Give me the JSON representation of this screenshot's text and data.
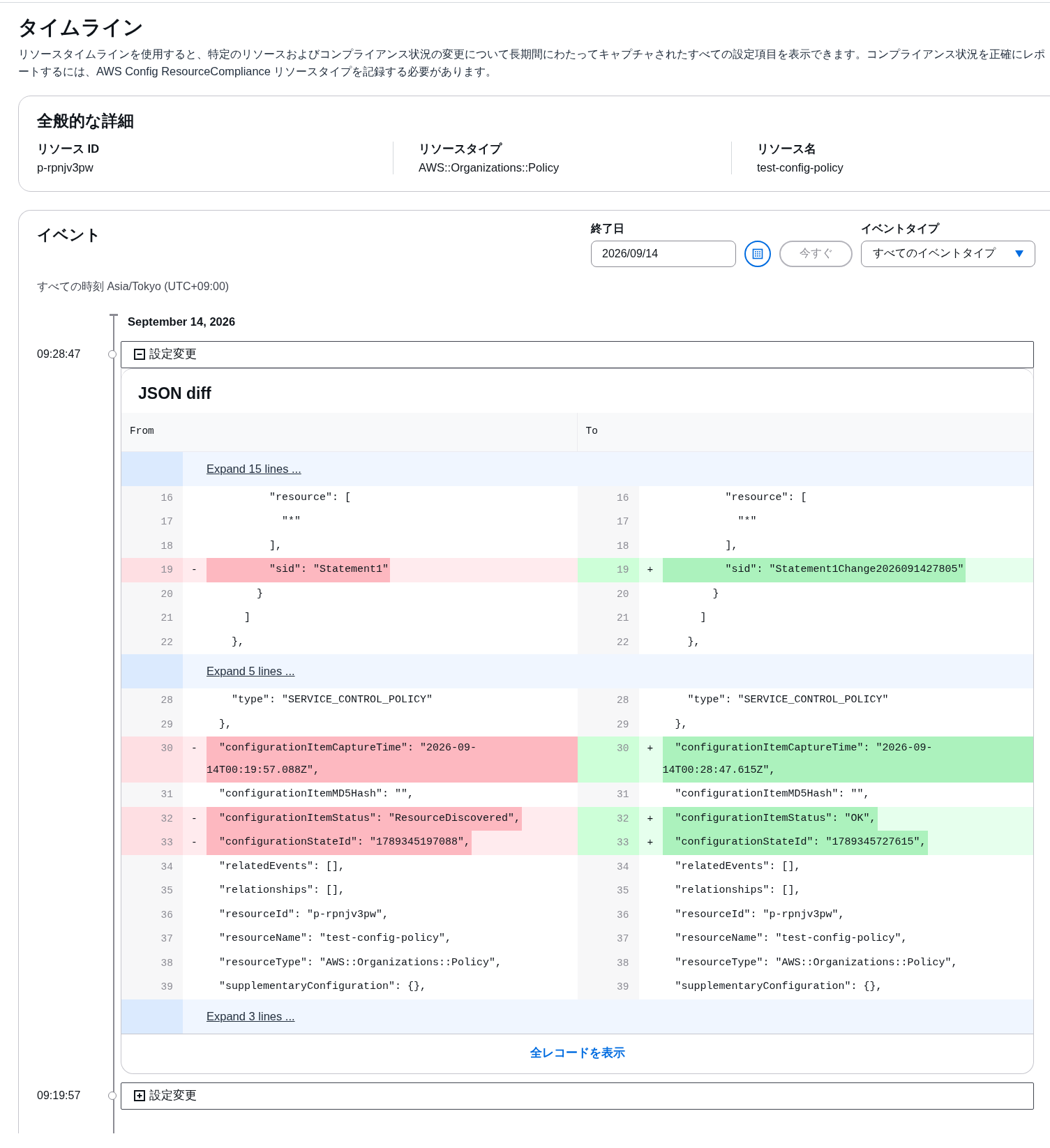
{
  "page": {
    "title": "タイムライン",
    "description": "リソースタイムラインを使用すると、特定のリソースおよびコンプライアンス状況の変更について長期間にわたってキャプチャされたすべての設定項目を表示できます。コンプライアンス状況を正確にレポートするには、AWS Config ResourceCompliance リソースタイプを記録する必要があります。"
  },
  "general": {
    "title": "全般的な詳細",
    "fields": [
      {
        "label": "リソース ID",
        "value": "p-rpnjv3pw"
      },
      {
        "label": "リソースタイプ",
        "value": "AWS::Organizations::Policy"
      },
      {
        "label": "リソース名",
        "value": "test-config-policy"
      }
    ]
  },
  "events_panel": {
    "title": "イベント",
    "timezone": "すべての時刻 Asia/Tokyo (UTC+09:00)",
    "end_date": {
      "label": "終了日",
      "value": "2026/09/14"
    },
    "now_button": {
      "label": "今すぐ",
      "disabled": true
    },
    "event_type": {
      "label": "イベントタイプ",
      "value": "すべてのイベントタイプ"
    },
    "date_heading": "September 14, 2026",
    "events": [
      {
        "time": "09:28:47",
        "label": "設定変更",
        "expanded": true,
        "diff": {
          "title": "JSON diff",
          "from_label": "From",
          "to_label": "To",
          "footer_link": "全レコードを表示",
          "rows": [
            {
              "kind": "expand",
              "label": "Expand 15 lines ..."
            },
            {
              "kind": "line",
              "from": {
                "num": "16",
                "text": "          \"resource\": [",
                "kind": "context"
              },
              "to": {
                "num": "16",
                "text": "          \"resource\": [",
                "kind": "context"
              }
            },
            {
              "kind": "line",
              "from": {
                "num": "17",
                "text": "            \"*\"",
                "kind": "context"
              },
              "to": {
                "num": "17",
                "text": "            \"*\"",
                "kind": "context"
              }
            },
            {
              "kind": "line",
              "from": {
                "num": "18",
                "text": "          ],",
                "kind": "context"
              },
              "to": {
                "num": "18",
                "text": "          ],",
                "kind": "context"
              }
            },
            {
              "kind": "line",
              "from": {
                "num": "19",
                "marker": "-",
                "text": "          \"sid\": \"Statement1\"",
                "kind": "removed"
              },
              "to": {
                "num": "19",
                "marker": "+",
                "text": "          \"sid\": \"Statement1Change2026091427805\"",
                "kind": "added"
              }
            },
            {
              "kind": "line",
              "from": {
                "num": "20",
                "text": "        }",
                "kind": "context"
              },
              "to": {
                "num": "20",
                "text": "        }",
                "kind": "context"
              }
            },
            {
              "kind": "line",
              "from": {
                "num": "21",
                "text": "      ]",
                "kind": "context"
              },
              "to": {
                "num": "21",
                "text": "      ]",
                "kind": "context"
              }
            },
            {
              "kind": "line",
              "from": {
                "num": "22",
                "text": "    },",
                "kind": "context"
              },
              "to": {
                "num": "22",
                "text": "    },",
                "kind": "context"
              }
            },
            {
              "kind": "expand",
              "label": "Expand 5 lines ..."
            },
            {
              "kind": "line",
              "from": {
                "num": "28",
                "text": "    \"type\": \"SERVICE_CONTROL_POLICY\"",
                "kind": "context"
              },
              "to": {
                "num": "28",
                "text": "    \"type\": \"SERVICE_CONTROL_POLICY\"",
                "kind": "context"
              }
            },
            {
              "kind": "line",
              "from": {
                "num": "29",
                "text": "  },",
                "kind": "context"
              },
              "to": {
                "num": "29",
                "text": "  },",
                "kind": "context"
              }
            },
            {
              "kind": "line",
              "from": {
                "num": "30",
                "marker": "-",
                "text": "  \"configurationItemCaptureTime\": \"2026-09-14T00:19:57.088Z\",",
                "kind": "removed"
              },
              "to": {
                "num": "30",
                "marker": "+",
                "text": "  \"configurationItemCaptureTime\": \"2026-09-14T00:28:47.615Z\",",
                "kind": "added"
              }
            },
            {
              "kind": "line",
              "from": {
                "num": "31",
                "text": "  \"configurationItemMD5Hash\": \"\",",
                "kind": "context"
              },
              "to": {
                "num": "31",
                "text": "  \"configurationItemMD5Hash\": \"\",",
                "kind": "context"
              }
            },
            {
              "kind": "line",
              "from": {
                "num": "32",
                "marker": "-",
                "text": "  \"configurationItemStatus\": \"ResourceDiscovered\",",
                "kind": "removed"
              },
              "to": {
                "num": "32",
                "marker": "+",
                "text": "  \"configurationItemStatus\": \"OK\",",
                "kind": "added"
              }
            },
            {
              "kind": "line",
              "from": {
                "num": "33",
                "marker": "-",
                "text": "  \"configurationStateId\": \"1789345197088\",",
                "kind": "removed"
              },
              "to": {
                "num": "33",
                "marker": "+",
                "text": "  \"configurationStateId\": \"1789345727615\",",
                "kind": "added"
              }
            },
            {
              "kind": "line",
              "from": {
                "num": "34",
                "text": "  \"relatedEvents\": [],",
                "kind": "context"
              },
              "to": {
                "num": "34",
                "text": "  \"relatedEvents\": [],",
                "kind": "context"
              }
            },
            {
              "kind": "line",
              "from": {
                "num": "35",
                "text": "  \"relationships\": [],",
                "kind": "context"
              },
              "to": {
                "num": "35",
                "text": "  \"relationships\": [],",
                "kind": "context"
              }
            },
            {
              "kind": "line",
              "from": {
                "num": "36",
                "text": "  \"resourceId\": \"p-rpnjv3pw\",",
                "kind": "context"
              },
              "to": {
                "num": "36",
                "text": "  \"resourceId\": \"p-rpnjv3pw\",",
                "kind": "context"
              }
            },
            {
              "kind": "line",
              "from": {
                "num": "37",
                "text": "  \"resourceName\": \"test-config-policy\",",
                "kind": "context"
              },
              "to": {
                "num": "37",
                "text": "  \"resourceName\": \"test-config-policy\",",
                "kind": "context"
              }
            },
            {
              "kind": "line",
              "from": {
                "num": "38",
                "text": "  \"resourceType\": \"AWS::Organizations::Policy\",",
                "kind": "context"
              },
              "to": {
                "num": "38",
                "text": "  \"resourceType\": \"AWS::Organizations::Policy\",",
                "kind": "context"
              }
            },
            {
              "kind": "line",
              "from": {
                "num": "39",
                "text": "  \"supplementaryConfiguration\": {},",
                "kind": "context"
              },
              "to": {
                "num": "39",
                "text": "  \"supplementaryConfiguration\": {},",
                "kind": "context"
              }
            },
            {
              "kind": "expand",
              "label": "Expand 3 lines ..."
            }
          ]
        }
      },
      {
        "time": "09:19:57",
        "label": "設定変更",
        "expanded": false
      }
    ]
  }
}
